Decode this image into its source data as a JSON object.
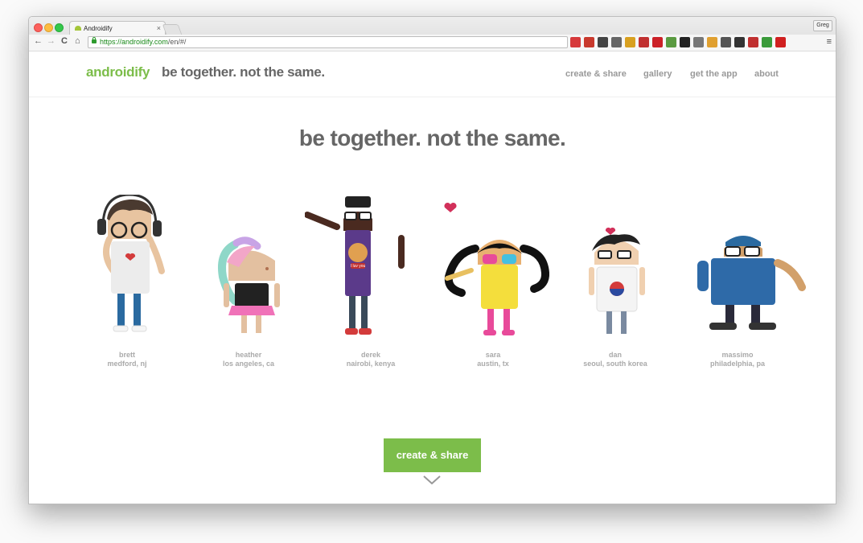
{
  "browser": {
    "tab_title": "Androidify",
    "tab_close": "×",
    "profile_name": "Greg",
    "url_host": "https://androidify.com",
    "url_path": "/en/#/",
    "back_glyph": "←",
    "forward_glyph": "→",
    "reload_glyph": "C",
    "home_glyph": "⌂",
    "menu_glyph": "≡",
    "extension_icons": [
      "pdf-icon",
      "print-icon",
      "font-icon",
      "pocket-icon",
      "color-wheel-icon",
      "bell-icon",
      "pinterest-icon",
      "evernote-icon",
      "amazon-icon",
      "cast-icon",
      "clipboard-icon",
      "recycle-icon",
      "checklist-icon",
      "pen-icon",
      "sync-icon",
      "gl-icon"
    ],
    "extension_colors": [
      "#d6393b",
      "#c8392d",
      "#444444",
      "#666666",
      "#d8a020",
      "#c03030",
      "#cb2027",
      "#5a9a40",
      "#222222",
      "#777777",
      "#e0a030",
      "#555555",
      "#333333",
      "#c03030",
      "#3a9a3a",
      "#d02020"
    ]
  },
  "header": {
    "logo": "androidify",
    "tagline": "be together. not the same.",
    "nav": {
      "create": "create & share",
      "gallery": "gallery",
      "get_app": "get the app",
      "about": "about"
    }
  },
  "main": {
    "headline": "be together. not the same.",
    "characters": [
      {
        "name": "brett",
        "location": "medford, nj"
      },
      {
        "name": "heather",
        "location": "los angeles, ca"
      },
      {
        "name": "derek",
        "location": "nairobi, kenya"
      },
      {
        "name": "sara",
        "location": "austin, tx"
      },
      {
        "name": "dan",
        "location": "seoul, south korea"
      },
      {
        "name": "massimo",
        "location": "philadelphia, pa"
      }
    ],
    "derek_shirt_text": "I luv you",
    "cta_label": "create & share"
  },
  "colors": {
    "brand_green": "#7cbd4a",
    "text_gray": "#666666",
    "caption_gray": "#aaaaaa"
  }
}
